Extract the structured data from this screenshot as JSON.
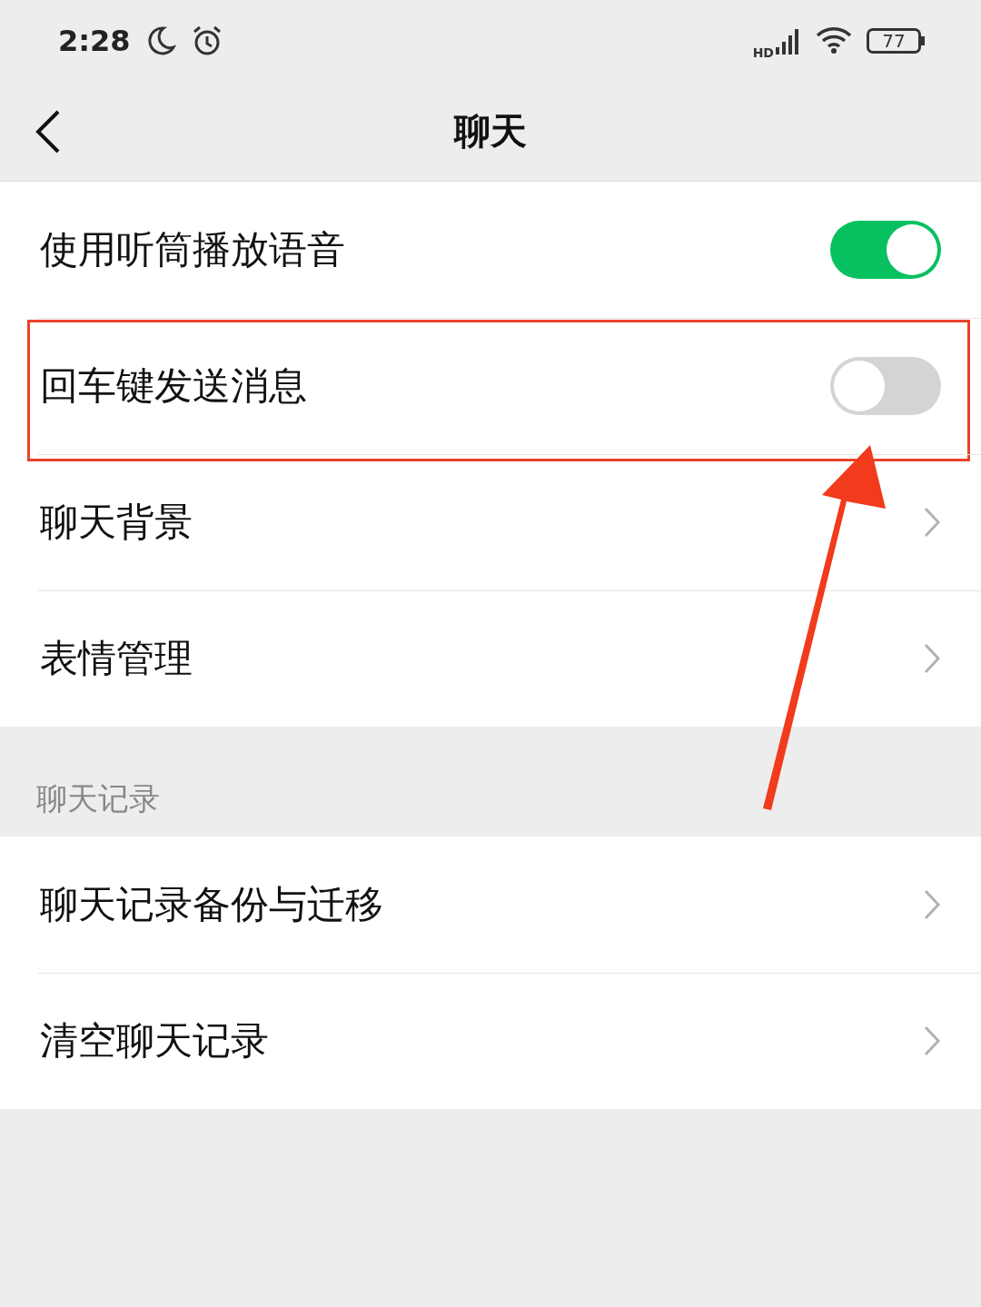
{
  "status_bar": {
    "time": "2:28",
    "network": "HD",
    "battery": "77"
  },
  "header": {
    "title": "聊天"
  },
  "sections": [
    {
      "rows": [
        {
          "label": "使用听筒播放语音",
          "kind": "toggle",
          "on": true,
          "highlighted": false
        },
        {
          "label": "回车键发送消息",
          "kind": "toggle",
          "on": false,
          "highlighted": true
        },
        {
          "label": "聊天背景",
          "kind": "link",
          "highlighted": false
        },
        {
          "label": "表情管理",
          "kind": "link",
          "highlighted": false
        }
      ]
    },
    {
      "title": "聊天记录",
      "rows": [
        {
          "label": "聊天记录备份与迁移",
          "kind": "link",
          "highlighted": false
        },
        {
          "label": "清空聊天记录",
          "kind": "link",
          "highlighted": false
        }
      ]
    }
  ]
}
